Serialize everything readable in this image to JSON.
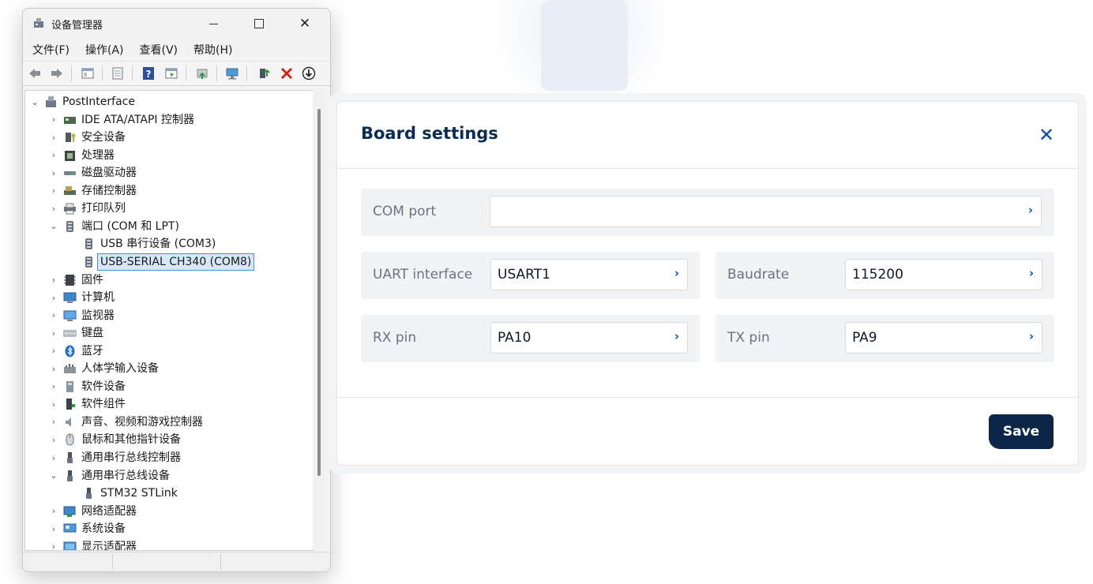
{
  "device_manager": {
    "title": "设备管理器",
    "close_glyph": "✕",
    "menu": [
      "文件(F)",
      "操作(A)",
      "查看(V)",
      "帮助(H)"
    ],
    "root_label": "PostInterface",
    "tree": [
      {
        "label": "IDE ATA/ATAPI 控制器",
        "icon": "ide-controller-icon",
        "chev": "›",
        "indent": 1
      },
      {
        "label": "安全设备",
        "icon": "security-device-icon",
        "chev": "›",
        "indent": 1
      },
      {
        "label": "处理器",
        "icon": "processor-icon",
        "chev": "›",
        "indent": 1
      },
      {
        "label": "磁盘驱动器",
        "icon": "disk-drive-icon",
        "chev": "›",
        "indent": 1
      },
      {
        "label": "存储控制器",
        "icon": "storage-controller-icon",
        "chev": "›",
        "indent": 1
      },
      {
        "label": "打印队列",
        "icon": "printer-icon",
        "chev": "›",
        "indent": 1
      },
      {
        "label": "端口 (COM 和 LPT)",
        "icon": "port-icon",
        "chev": "⌄",
        "indent": 1
      },
      {
        "label": "USB 串行设备 (COM3)",
        "icon": "port-icon",
        "chev": "",
        "indent": 2
      },
      {
        "label": "USB-SERIAL CH340 (COM8)",
        "icon": "port-icon",
        "chev": "",
        "indent": 2,
        "selected": true
      },
      {
        "label": "固件",
        "icon": "firmware-icon",
        "chev": "›",
        "indent": 1
      },
      {
        "label": "计算机",
        "icon": "computer-icon",
        "chev": "›",
        "indent": 1
      },
      {
        "label": "监视器",
        "icon": "monitor-icon",
        "chev": "›",
        "indent": 1
      },
      {
        "label": "键盘",
        "icon": "keyboard-icon",
        "chev": "›",
        "indent": 1
      },
      {
        "label": "蓝牙",
        "icon": "bluetooth-icon",
        "chev": "›",
        "indent": 1
      },
      {
        "label": "人体学输入设备",
        "icon": "hid-icon",
        "chev": "›",
        "indent": 1
      },
      {
        "label": "软件设备",
        "icon": "software-device-icon",
        "chev": "›",
        "indent": 1
      },
      {
        "label": "软件组件",
        "icon": "software-component-icon",
        "chev": "›",
        "indent": 1
      },
      {
        "label": "声音、视频和游戏控制器",
        "icon": "audio-icon",
        "chev": "›",
        "indent": 1
      },
      {
        "label": "鼠标和其他指针设备",
        "icon": "mouse-icon",
        "chev": "›",
        "indent": 1
      },
      {
        "label": "通用串行总线控制器",
        "icon": "usb-icon",
        "chev": "›",
        "indent": 1
      },
      {
        "label": "通用串行总线设备",
        "icon": "usb-icon",
        "chev": "⌄",
        "indent": 1
      },
      {
        "label": "STM32 STLink",
        "icon": "usb-icon",
        "chev": "",
        "indent": 2
      },
      {
        "label": "网络适配器",
        "icon": "network-adapter-icon",
        "chev": "›",
        "indent": 1
      },
      {
        "label": "系统设备",
        "icon": "system-device-icon",
        "chev": "›",
        "indent": 1
      },
      {
        "label": "显示适配器",
        "icon": "display-adapter-icon",
        "chev": "›",
        "indent": 1
      }
    ]
  },
  "board_settings": {
    "title": "Board settings",
    "close_glyph": "✕",
    "chevron_glyph": "›",
    "com_port": {
      "label": "COM port",
      "value": ""
    },
    "uart_interface": {
      "label": "UART interface",
      "value": "USART1"
    },
    "baudrate": {
      "label": "Baudrate",
      "value": "115200"
    },
    "rx_pin": {
      "label": "RX pin",
      "value": "PA10"
    },
    "tx_pin": {
      "label": "TX pin",
      "value": "PA9"
    },
    "save_label": "Save"
  },
  "colors": {
    "accent": "#0b4ea2",
    "title": "#0b2c52",
    "save_button": "#0b2646",
    "selection": "#d8e7f7"
  }
}
